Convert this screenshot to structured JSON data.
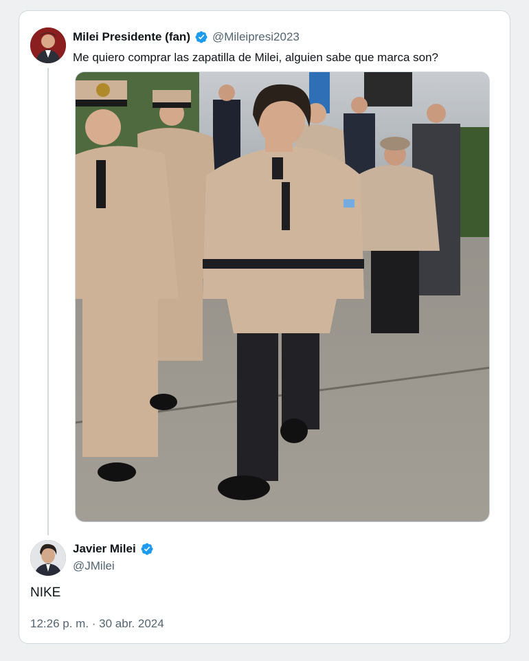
{
  "quoted_post": {
    "display_name": "Milei Presidente (fan)",
    "handle": "@Mileipresi2023",
    "text": "Me quiero comprar las zapatilla de Milei, alguien sabe que marca son?",
    "verified": true
  },
  "reply_post": {
    "display_name": "Javier Milei",
    "handle": "@JMilei",
    "text": "NIKE",
    "verified": true,
    "timestamp": "12:26 p. m. · 30 abr. 2024"
  },
  "colors": {
    "verified_blue": "#1d9bf0",
    "text_primary": "#0f1419",
    "text_secondary": "#536471",
    "border": "#cfd9de"
  },
  "icons": {
    "verified": "verified-badge-icon"
  }
}
